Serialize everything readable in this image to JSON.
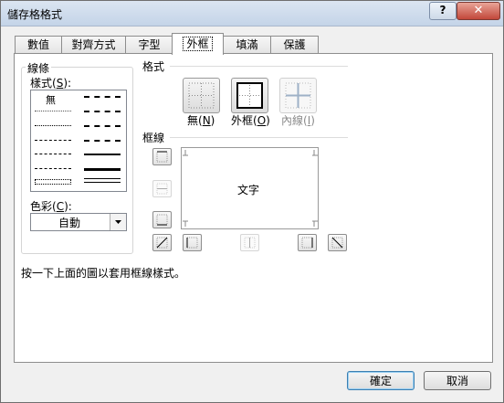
{
  "window": {
    "title": "儲存格格式",
    "help_label": "?",
    "close_label": "✕"
  },
  "tabs": [
    "數值",
    "對齊方式",
    "字型",
    "外框",
    "填滿",
    "保護"
  ],
  "active_tab": "外框",
  "line": {
    "group_label": "線條",
    "style_label": "樣式(S):",
    "none_label": "無",
    "color_label": "色彩(C):",
    "color_value": "自動"
  },
  "presets": {
    "section_label": "格式",
    "none_label": "無(N)",
    "outline_label": "外框(O)",
    "inside_label": "內線(I)"
  },
  "border": {
    "section_label": "框線",
    "preview_text": "文字"
  },
  "hint": "按一下上面的圖以套用框線樣式。",
  "buttons": {
    "ok": "確定",
    "cancel": "取消"
  }
}
